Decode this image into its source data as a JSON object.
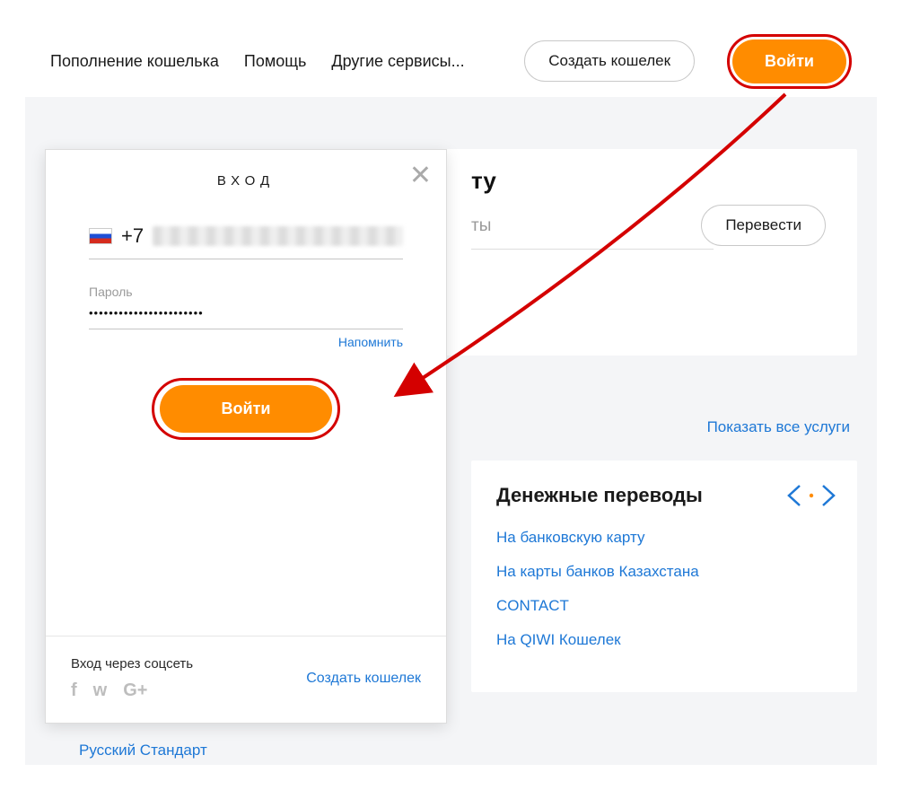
{
  "colors": {
    "accent": "#ff8c00",
    "link": "#1e78d6",
    "annotation": "#d40000"
  },
  "header": {
    "nav": {
      "wallet_topup": "Пополнение кошелька",
      "help": "Помощь",
      "other": "Другие сервисы..."
    },
    "create_wallet": "Создать кошелек",
    "login": "Войти"
  },
  "hero": {
    "title_fragment": "ту",
    "input_fragment": "ты",
    "transfer_button": "Перевести"
  },
  "show_all": "Показать все услуги",
  "transfers": {
    "title": "Денежные переводы",
    "links": [
      "На банковскую карту",
      "На карты банков Казахстана",
      "CONTACT",
      "На QIWI Кошелек"
    ]
  },
  "left_links": {
    "ru_standard": "Русский Стандарт"
  },
  "modal": {
    "title": "ВХОД",
    "phone_prefix": "+7",
    "password_label": "Пароль",
    "password_mask": "•••••••••••••••••••••••",
    "remind": "Напомнить",
    "submit": "Войти",
    "social_title": "Вход через соцсеть",
    "social": {
      "fb": "f",
      "vk": "w",
      "gplus": "G+"
    },
    "create_wallet": "Создать кошелек"
  }
}
